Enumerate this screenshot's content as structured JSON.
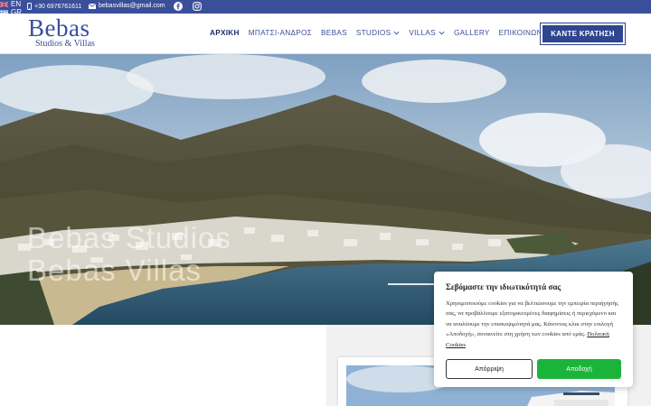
{
  "topbar": {
    "phone": "+30 6976761611",
    "email": "bebasvillas@gmail.com",
    "languages": [
      {
        "code": "EN"
      },
      {
        "code": "GR"
      }
    ]
  },
  "logo": {
    "main": "Bebas",
    "sub": "Studios & Villas"
  },
  "nav": {
    "items": [
      {
        "label": "ΑΡΧΙΚΗ"
      },
      {
        "label": "ΜΠΑΤΣΙ-ΑΝΔΡΟΣ"
      },
      {
        "label": "BEBAS"
      },
      {
        "label": "STUDIOS"
      },
      {
        "label": "VILLAS"
      },
      {
        "label": "GALLERY"
      },
      {
        "label": "ΕΠΙΚΟΙΝΩΝΙΑ"
      }
    ],
    "book_label": "ΚΑΝΤΕ ΚΡΑΤΗΣΗ"
  },
  "hero": {
    "line1": "Bebas Studios",
    "line2": "Bebas Villas"
  },
  "cookie": {
    "title": "Σεβόμαστε την ιδιωτικότητά σας",
    "text": "Χρησιμοποιούμε cookies για να βελτιώσουμε την εμπειρία περιήγησής σας, να προβάλλουμε εξατομικευμένες διαφημίσεις ή περιεχόμενο και να αναλύουμε την επισκεψιμότητά μας. Κάνοντας κλικ στην επιλογή «Αποδοχή», συναινείτε στη χρήση των cookies από εμάς.",
    "link": "Πολιτική Cookies",
    "reject_label": "Απόρριψη",
    "accept_label": "Αποδοχή"
  },
  "colors": {
    "brand": "#3a4f9a",
    "accept": "#1bb43b"
  }
}
